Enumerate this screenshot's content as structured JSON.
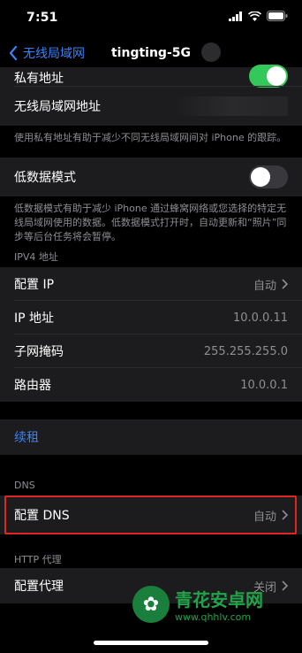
{
  "status": {
    "time": "7:51"
  },
  "nav": {
    "back_label": "无线局域网",
    "title": "tingting-5G"
  },
  "private_address": {
    "label": "私有地址",
    "toggle_on": true
  },
  "wifi_address": {
    "label": "无线局域网地址"
  },
  "private_note": "使用私有地址有助于减少不同无线局域网间对 iPhone 的跟踪。",
  "low_data": {
    "label": "低数据模式",
    "toggle_on": false,
    "note": "低数据模式有助于减少 iPhone 通过蜂窝网络或您选择的特定无线局域网使用的数据。低数据模式打开时，自动更新和“照片”同步等后台任务将会暂停。"
  },
  "ipv4": {
    "header": "IPV4 地址",
    "rows": [
      {
        "label": "配置 IP",
        "value": "自动"
      },
      {
        "label": "IP 地址",
        "value": "10.0.0.11"
      },
      {
        "label": "子网掩码",
        "value": "255.255.255.0"
      },
      {
        "label": "路由器",
        "value": "10.0.0.1"
      }
    ]
  },
  "renew": {
    "label": "续租"
  },
  "dns": {
    "header": "DNS",
    "configure_label": "配置 DNS",
    "configure_value": "自动"
  },
  "proxy": {
    "header": "HTTP 代理",
    "configure_label": "配置代理",
    "configure_value": "关闭"
  },
  "watermark": {
    "title": "青花安卓网",
    "url": "www.qhhlv.com"
  },
  "colors": {
    "accent": "#3b82f6",
    "toggle_on": "#34c759",
    "highlight": "#e02525"
  }
}
